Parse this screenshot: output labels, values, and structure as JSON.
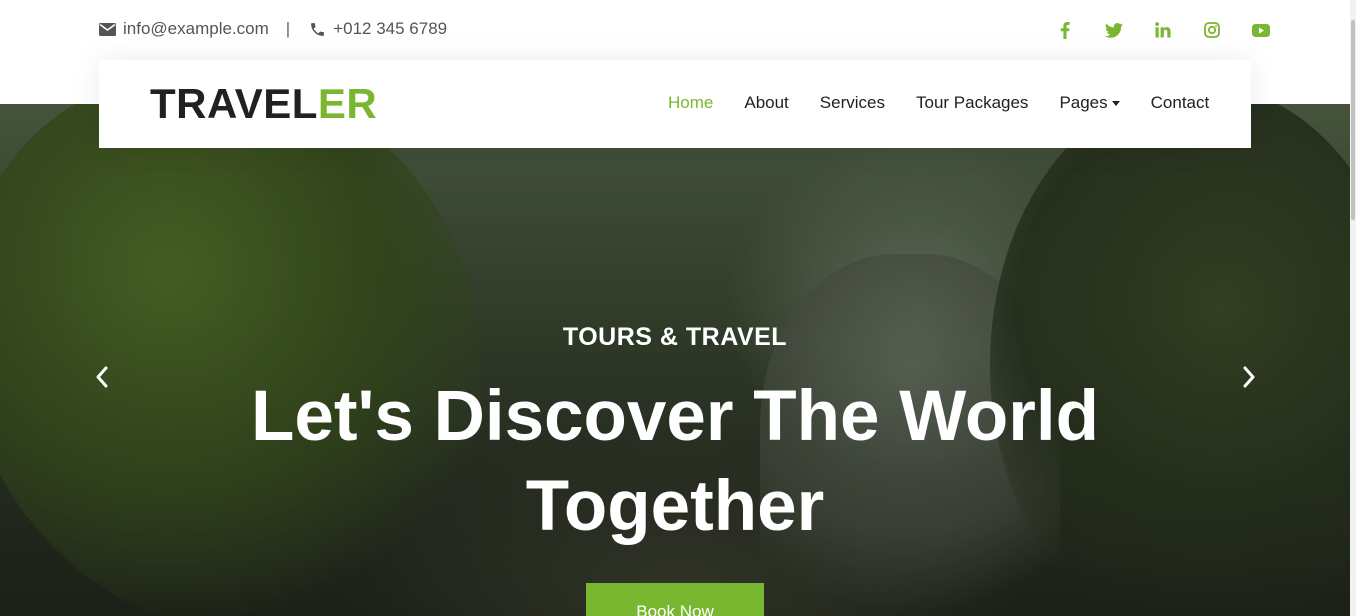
{
  "topbar": {
    "email": "info@example.com",
    "separator": "|",
    "phone": "+012 345 6789",
    "icons": {
      "email": "envelope-icon",
      "phone": "phone-icon"
    },
    "social": [
      "facebook-icon",
      "twitter-icon",
      "linkedin-icon",
      "instagram-icon",
      "youtube-icon"
    ]
  },
  "brand": {
    "part1": "TRAVEL",
    "part2": "ER"
  },
  "nav": {
    "items": [
      {
        "label": "Home",
        "active": true
      },
      {
        "label": "About"
      },
      {
        "label": "Services"
      },
      {
        "label": "Tour Packages"
      },
      {
        "label": "Pages",
        "dropdown": true
      },
      {
        "label": "Contact"
      }
    ]
  },
  "hero": {
    "kicker": "TOURS & TRAVEL",
    "headline": "Let's Discover The World Together",
    "button": "Book Now"
  },
  "colors": {
    "accent": "#7ab730",
    "text": "#212121",
    "muted": "#555555"
  }
}
